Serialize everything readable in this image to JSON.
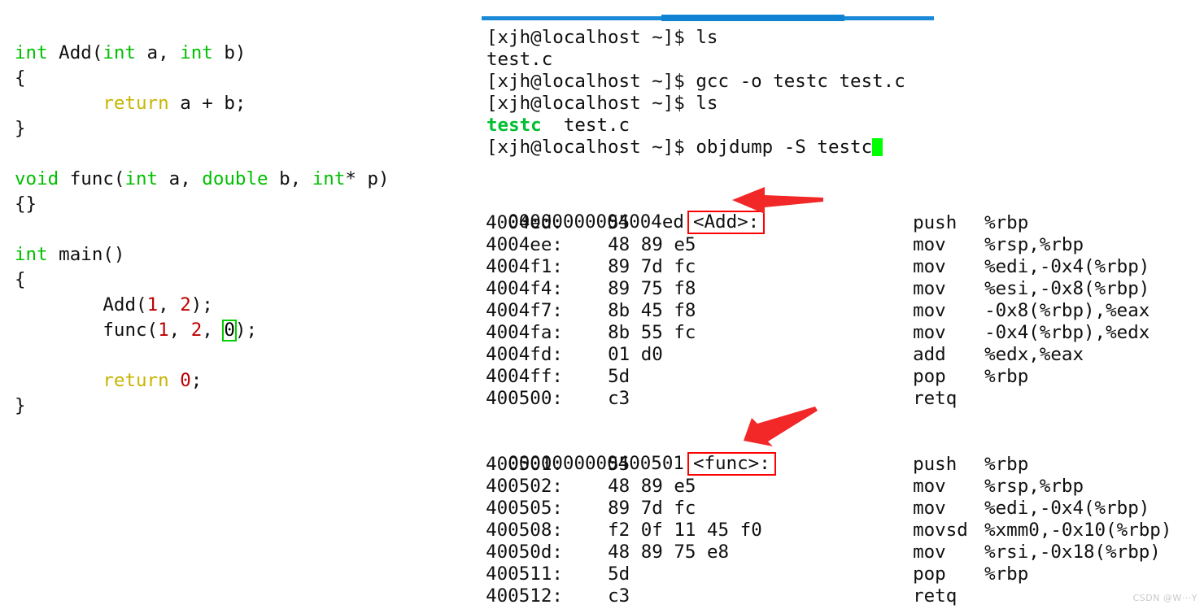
{
  "editor": {
    "source_lines": [
      [
        {
          "t": "int",
          "c": "kw"
        },
        {
          "t": " Add(",
          "c": "plain"
        },
        {
          "t": "int",
          "c": "kw"
        },
        {
          "t": " a, ",
          "c": "plain"
        },
        {
          "t": "int",
          "c": "kw"
        },
        {
          "t": " b)",
          "c": "plain"
        }
      ],
      [
        {
          "t": "{",
          "c": "plain"
        }
      ],
      [
        {
          "t": "        ",
          "c": "plain"
        },
        {
          "t": "return",
          "c": "ret"
        },
        {
          "t": " a + b;",
          "c": "plain"
        }
      ],
      [
        {
          "t": "}",
          "c": "plain"
        }
      ],
      [],
      [
        {
          "t": "void",
          "c": "kw"
        },
        {
          "t": " func(",
          "c": "plain"
        },
        {
          "t": "int",
          "c": "kw"
        },
        {
          "t": " a, ",
          "c": "plain"
        },
        {
          "t": "double",
          "c": "kw"
        },
        {
          "t": " b, ",
          "c": "plain"
        },
        {
          "t": "int",
          "c": "kw"
        },
        {
          "t": "* p)",
          "c": "plain"
        }
      ],
      [
        {
          "t": "{}",
          "c": "plain"
        }
      ],
      [],
      [
        {
          "t": "int",
          "c": "kw"
        },
        {
          "t": " main()",
          "c": "plain"
        }
      ],
      [
        {
          "t": "{",
          "c": "plain"
        }
      ],
      [
        {
          "t": "        Add(",
          "c": "plain"
        },
        {
          "t": "1",
          "c": "num"
        },
        {
          "t": ", ",
          "c": "plain"
        },
        {
          "t": "2",
          "c": "num"
        },
        {
          "t": ");",
          "c": "plain"
        }
      ],
      [
        {
          "t": "        func(",
          "c": "plain"
        },
        {
          "t": "1",
          "c": "num"
        },
        {
          "t": ", ",
          "c": "plain"
        },
        {
          "t": "2",
          "c": "num"
        },
        {
          "t": ", ",
          "c": "plain"
        },
        {
          "t": "0",
          "c": "cursor-box"
        },
        {
          "t": ");",
          "c": "plain"
        }
      ],
      [],
      [
        {
          "t": "        ",
          "c": "plain"
        },
        {
          "t": "return",
          "c": "ret"
        },
        {
          "t": " ",
          "c": "plain"
        },
        {
          "t": "0",
          "c": "num"
        },
        {
          "t": ";",
          "c": "plain"
        }
      ],
      [
        {
          "t": "}",
          "c": "plain"
        }
      ]
    ]
  },
  "terminal": {
    "prompt": "[xjh@localhost ~]$ ",
    "lines": [
      {
        "type": "command",
        "prompt": "[xjh@localhost ~]$ ",
        "command": "ls"
      },
      {
        "type": "output",
        "text": "test.c"
      },
      {
        "type": "command",
        "prompt": "[xjh@localhost ~]$ ",
        "command": "gcc -o testc test.c"
      },
      {
        "type": "command",
        "prompt": "[xjh@localhost ~]$ ",
        "command": "ls"
      },
      {
        "type": "output_exe",
        "exe": "testc",
        "rest": "  test.c"
      },
      {
        "type": "command_cursor",
        "prompt": "[xjh@localhost ~]$ ",
        "command": "objdump -S testc"
      }
    ]
  },
  "disassembly": {
    "sections": [
      {
        "address": "00000000004004ed",
        "symbol": "<Add>:",
        "rows": [
          {
            "addr": "4004ed:",
            "bytes": "55",
            "mnemonic": "push",
            "operands": "%rbp"
          },
          {
            "addr": "4004ee:",
            "bytes": "48 89 e5",
            "mnemonic": "mov",
            "operands": "%rsp,%rbp"
          },
          {
            "addr": "4004f1:",
            "bytes": "89 7d fc",
            "mnemonic": "mov",
            "operands": "%edi,-0x4(%rbp)"
          },
          {
            "addr": "4004f4:",
            "bytes": "89 75 f8",
            "mnemonic": "mov",
            "operands": "%esi,-0x8(%rbp)"
          },
          {
            "addr": "4004f7:",
            "bytes": "8b 45 f8",
            "mnemonic": "mov",
            "operands": "-0x8(%rbp),%eax"
          },
          {
            "addr": "4004fa:",
            "bytes": "8b 55 fc",
            "mnemonic": "mov",
            "operands": "-0x4(%rbp),%edx"
          },
          {
            "addr": "4004fd:",
            "bytes": "01 d0",
            "mnemonic": "add",
            "operands": "%edx,%eax"
          },
          {
            "addr": "4004ff:",
            "bytes": "5d",
            "mnemonic": "pop",
            "operands": "%rbp"
          },
          {
            "addr": "400500:",
            "bytes": "c3",
            "mnemonic": "retq",
            "operands": ""
          }
        ]
      },
      {
        "address": "0000000000400501",
        "symbol": "<func>:",
        "rows": [
          {
            "addr": "400501:",
            "bytes": "55",
            "mnemonic": "push",
            "operands": "%rbp"
          },
          {
            "addr": "400502:",
            "bytes": "48 89 e5",
            "mnemonic": "mov",
            "operands": "%rsp,%rbp"
          },
          {
            "addr": "400505:",
            "bytes": "89 7d fc",
            "mnemonic": "mov",
            "operands": "%edi,-0x4(%rbp)"
          },
          {
            "addr": "400508:",
            "bytes": "f2 0f 11 45 f0",
            "mnemonic": "movsd",
            "operands": "%xmm0,-0x10(%rbp)"
          },
          {
            "addr": "40050d:",
            "bytes": "48 89 75 e8",
            "mnemonic": "mov",
            "operands": "%rsi,-0x18(%rbp)"
          },
          {
            "addr": "400511:",
            "bytes": "5d",
            "mnemonic": "pop",
            "operands": "%rbp"
          },
          {
            "addr": "400512:",
            "bytes": "c3",
            "mnemonic": "retq",
            "operands": ""
          }
        ]
      }
    ]
  },
  "annotations": {
    "arrow_color": "#f22727",
    "box_color": "#ff0000",
    "arrows": [
      {
        "name": "arrow-to-add-symbol",
        "direction": "left"
      },
      {
        "name": "arrow-to-func-symbol",
        "direction": "down-left"
      }
    ]
  },
  "watermark": {
    "text": "CSDN @W···Y"
  },
  "colors": {
    "keyword_green": "#00c000",
    "return_yellow": "#c8b400",
    "number_red": "#c00000",
    "terminal_exe_green": "#00c030",
    "cursor_green": "#00ff00",
    "titlebar_blue": "#1a8ad8",
    "annotation_red": "#ff0000"
  }
}
